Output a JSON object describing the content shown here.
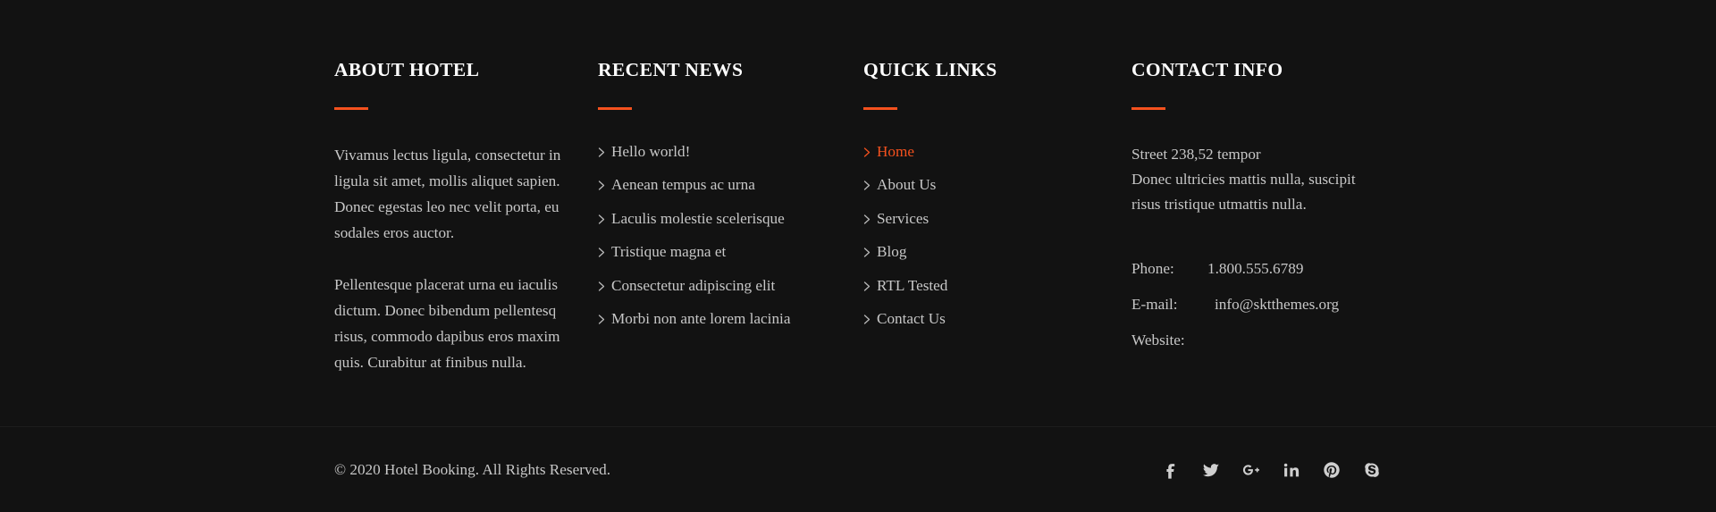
{
  "theme": {
    "background": "#121212",
    "accent": "#f4511e",
    "heading_color": "#ffffff",
    "text_color": "#c7c7c7"
  },
  "columns": {
    "about": {
      "title": "ABOUT HOTEL",
      "paragraphs": [
        "Vivamus lectus ligula, consectetur in ligula sit amet, mollis aliquet sapien. Donec egestas leo nec velit porta, eu sodales eros auctor.",
        "Pellentesque placerat urna eu iaculis dictum. Donec bibendum pellentesq risus, commodo dapibus eros maxim quis. Curabitur at finibus nulla."
      ]
    },
    "recent_news": {
      "title": "RECENT NEWS",
      "items": [
        {
          "label": "Hello world!",
          "active": false
        },
        {
          "label": "Aenean tempus ac urna",
          "active": false
        },
        {
          "label": "Laculis molestie scelerisque",
          "active": false
        },
        {
          "label": "Tristique magna et",
          "active": false
        },
        {
          "label": "Consectetur adipiscing elit",
          "active": false
        },
        {
          "label": "Morbi non ante lorem lacinia",
          "active": false
        }
      ]
    },
    "quick_links": {
      "title": "QUICK LINKS",
      "items": [
        {
          "label": "Home",
          "active": true
        },
        {
          "label": "About Us",
          "active": false
        },
        {
          "label": "Services",
          "active": false
        },
        {
          "label": "Blog",
          "active": false
        },
        {
          "label": "RTL Tested",
          "active": false
        },
        {
          "label": "Contact Us",
          "active": false
        }
      ]
    },
    "contact_info": {
      "title": "CONTACT INFO",
      "address_lines": [
        "Street 238,52 tempor",
        "Donec ultricies mattis nulla, suscipit",
        "risus tristique utmattis nulla."
      ],
      "details": [
        {
          "label": "Phone:",
          "value": "1.800.555.6789"
        },
        {
          "label": "E-mail:",
          "value": "info@sktthemes.org"
        },
        {
          "label": "Website:",
          "value": ""
        }
      ]
    }
  },
  "bottom_bar": {
    "copyright": "© 2020 Hotel Booking. All Rights Reserved.",
    "socials": [
      {
        "name": "facebook-icon"
      },
      {
        "name": "twitter-icon"
      },
      {
        "name": "google-plus-icon"
      },
      {
        "name": "linkedin-icon"
      },
      {
        "name": "pinterest-icon"
      },
      {
        "name": "skype-icon"
      }
    ]
  }
}
